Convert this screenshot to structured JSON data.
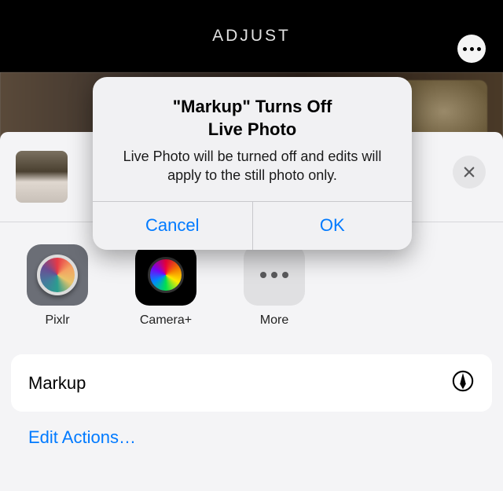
{
  "header": {
    "title": "ADJUST"
  },
  "sheet": {
    "apps": [
      {
        "label": "Pixlr"
      },
      {
        "label": "Camera+"
      },
      {
        "label": "More"
      }
    ],
    "actions": {
      "markup_label": "Markup",
      "edit_actions_label": "Edit Actions…"
    }
  },
  "alert": {
    "title_line1": "\"Markup\" Turns Off",
    "title_line2": "Live Photo",
    "message": "Live Photo will be turned off and edits will apply to the still photo only.",
    "cancel_label": "Cancel",
    "ok_label": "OK"
  },
  "colors": {
    "accent": "#007aff"
  }
}
